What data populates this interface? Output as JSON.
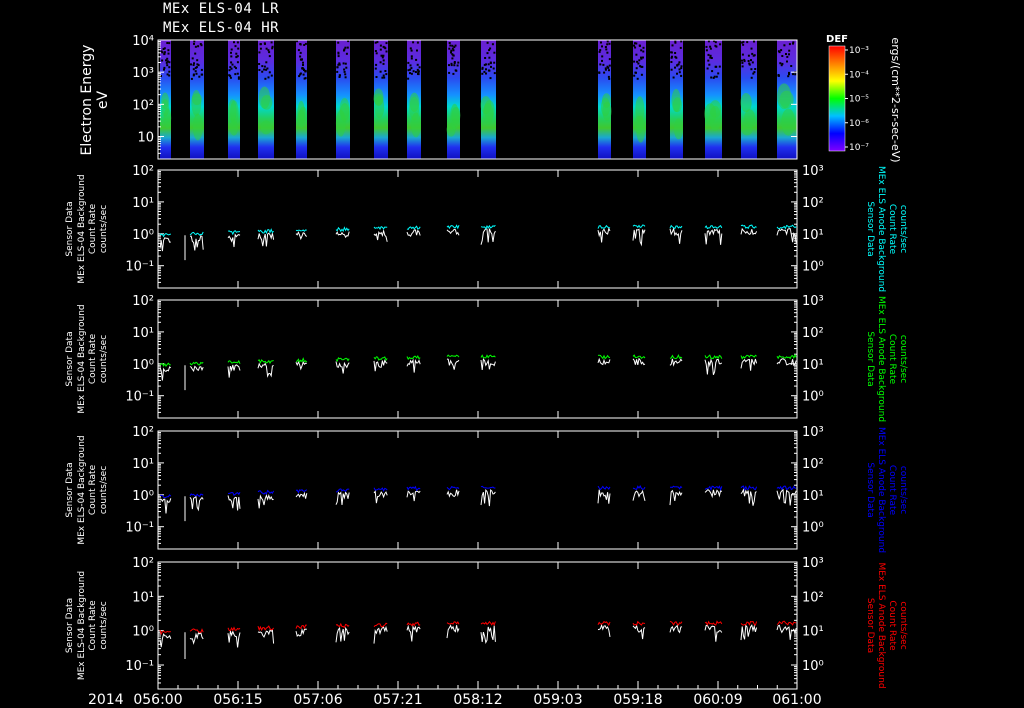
{
  "header": {
    "title_lr": "MEx ELS-04 LR",
    "title_hr": "MEx ELS-04 HR"
  },
  "chart_data": [
    {
      "type": "heatmap",
      "title": "",
      "ylabel": "Electron Energy",
      "yunit": "eV",
      "yscale": "log",
      "ylim": [
        2,
        10000
      ],
      "y_ticks": [
        "10",
        "10²",
        "10³",
        "10⁴"
      ],
      "colorbar": {
        "label": "DEF",
        "unit": "ergs/(cm**2-sr-sec-eV)",
        "ticks": [
          "10⁻³",
          "10⁻⁴",
          "10⁻⁵",
          "10⁻⁶",
          "10⁻⁷"
        ],
        "colors": [
          "#ff0000",
          "#ff8000",
          "#ffff00",
          "#00ff00",
          "#00c0ff",
          "#0000ff",
          "#8000ff"
        ]
      },
      "data_windows_x": [
        0.01,
        0.09,
        0.15,
        0.21,
        0.27,
        0.33,
        0.39,
        0.44,
        0.5,
        0.56,
        0.62,
        0.68,
        0.74,
        0.8,
        0.88,
        0.94,
        1.0,
        1.07,
        1.13
      ]
    },
    {
      "type": "line",
      "left_label": [
        "Sensor Data",
        "MEx ELS-04 Background",
        "Count Rate",
        "counts/sec"
      ],
      "right_label": [
        "Sensor Data",
        "MEx ELS Anode Background",
        "Count Rate",
        "counts/sec"
      ],
      "series_color": "#00ffff",
      "left_ticks": [
        "10⁻¹",
        "10⁰",
        "10¹",
        "10²"
      ],
      "right_ticks": [
        "10⁰",
        "10¹",
        "10²",
        "10³"
      ],
      "yscale": "log",
      "ylim": [
        0.02,
        100
      ]
    },
    {
      "type": "line",
      "left_label": [
        "Sensor Data",
        "MEx ELS-04 Background",
        "Count Rate",
        "counts/sec"
      ],
      "right_label": [
        "Sensor Data",
        "MEx ELS Anode Background",
        "Count Rate",
        "counts/sec"
      ],
      "series_color": "#00ff00",
      "left_ticks": [
        "10⁻¹",
        "10⁰",
        "10¹",
        "10²"
      ],
      "right_ticks": [
        "10⁰",
        "10¹",
        "10²",
        "10³"
      ],
      "yscale": "log",
      "ylim": [
        0.02,
        100
      ]
    },
    {
      "type": "line",
      "left_label": [
        "Sensor Data",
        "MEx ELS-04 Background",
        "Count Rate",
        "counts/sec"
      ],
      "right_label": [
        "Sensor Data",
        "MEx ELS Anode Background",
        "Count Rate",
        "counts/sec"
      ],
      "series_color": "#0000ff",
      "left_ticks": [
        "10⁻¹",
        "10⁰",
        "10¹",
        "10²"
      ],
      "right_ticks": [
        "10⁰",
        "10¹",
        "10²",
        "10³"
      ],
      "yscale": "log",
      "ylim": [
        0.02,
        100
      ]
    },
    {
      "type": "line",
      "left_label": [
        "Sensor Data",
        "MEx ELS-04 Background",
        "Count Rate",
        "counts/sec"
      ],
      "right_label": [
        "Sensor Data",
        "MEx ELS Anode Background",
        "Count Rate",
        "counts/sec"
      ],
      "series_color": "#ff0000",
      "left_ticks": [
        "10⁻¹",
        "10⁰",
        "10¹",
        "10²"
      ],
      "right_ticks": [
        "10⁰",
        "10¹",
        "10²",
        "10³"
      ],
      "yscale": "log",
      "ylim": [
        0.02,
        100
      ]
    }
  ],
  "x_axis": {
    "year": "2014",
    "tick_labels": [
      "056:00",
      "056:15",
      "057:06",
      "057:21",
      "058:12",
      "059:03",
      "059:18",
      "060:09",
      "061:00"
    ]
  }
}
